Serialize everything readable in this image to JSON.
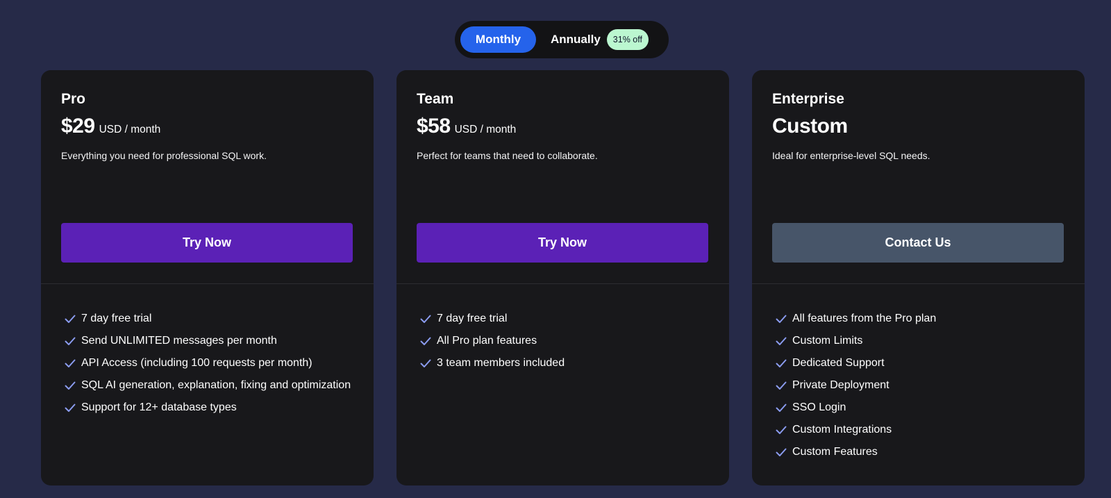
{
  "billing_toggle": {
    "monthly_label": "Monthly",
    "annually_label": "Annually",
    "discount_badge": "31% off",
    "selected": "Monthly"
  },
  "colors": {
    "background": "#262a48",
    "card": "#18181b",
    "toggle_active": "#2563eb",
    "cta_primary": "#5b21b6",
    "cta_secondary": "#475569",
    "badge": "#bbf7d0",
    "check": "#8b9cf0"
  },
  "plans": [
    {
      "name": "Pro",
      "price": "$29",
      "price_unit": "USD / month",
      "description": "Everything you need for professional SQL work.",
      "cta_label": "Try Now",
      "features": [
        "7 day free trial",
        "Send UNLIMITED messages per month",
        "API Access (including 100 requests per month)",
        "SQL AI generation, explanation, fixing and optimization",
        "Support for 12+ database types"
      ]
    },
    {
      "name": "Team",
      "price": "$58",
      "price_unit": "USD / month",
      "description": "Perfect for teams that need to collaborate.",
      "cta_label": "Try Now",
      "features": [
        "7 day free trial",
        "All Pro plan features",
        "3 team members included"
      ]
    },
    {
      "name": "Enterprise",
      "price": "Custom",
      "price_unit": "",
      "description": "Ideal for enterprise-level SQL needs.",
      "cta_label": "Contact Us",
      "features": [
        "All features from the Pro plan",
        "Custom Limits",
        "Dedicated Support",
        "Private Deployment",
        "SSO Login",
        "Custom Integrations",
        "Custom Features"
      ]
    }
  ],
  "icons": {
    "feature_check": "check-icon"
  }
}
